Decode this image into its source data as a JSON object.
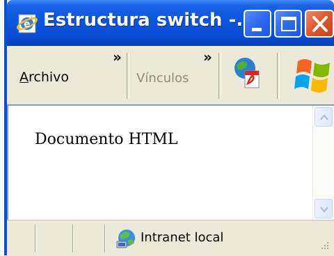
{
  "window": {
    "title": "Estructura switch -...",
    "controls": {
      "minimize": "minimize",
      "maximize": "maximize",
      "close": "close"
    }
  },
  "toolbar": {
    "menu_file": {
      "accel": "A",
      "rest": "rchivo"
    },
    "chevron": "»",
    "links_label": "Vínculos",
    "icons": [
      "internet-explorer-icon",
      "pdf-icon",
      "windows-flag-icon"
    ]
  },
  "content": {
    "text": "Documento HTML"
  },
  "statusbar": {
    "zone_label": "Intranet local"
  },
  "colors": {
    "titlebar": "#0a4fd8",
    "chrome": "#ece9d8",
    "close_button": "#e05a30",
    "border": "#7f9db9"
  }
}
